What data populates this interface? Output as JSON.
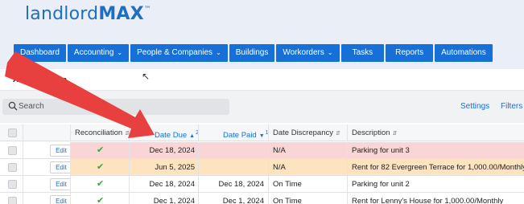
{
  "app": {
    "logo_light": "landlord",
    "logo_bold": "MAX",
    "logo_tm": "™"
  },
  "nav": [
    {
      "label": "Dashboard",
      "dropdown": false
    },
    {
      "label": "Accounting",
      "dropdown": true
    },
    {
      "label": "People & Companies",
      "dropdown": true
    },
    {
      "label": "Buildings",
      "dropdown": false
    },
    {
      "label": "Workorders",
      "dropdown": true
    },
    {
      "label": "Tasks",
      "dropdown": false
    },
    {
      "label": "Reports",
      "dropdown": false
    },
    {
      "label": "Automations",
      "dropdown": false
    }
  ],
  "page": {
    "title": "Accounting En"
  },
  "toolbar": {
    "search_placeholder": "Search",
    "settings_label": "Settings",
    "filters_label": "Filters"
  },
  "table": {
    "headers": {
      "reconciliation": "Reconciliation",
      "date_due": "Date Due",
      "date_due_sort": "2",
      "date_paid": "Date Paid",
      "date_paid_sort": "1",
      "date_discrepancy": "Date Discrepancy",
      "description": "Description"
    },
    "edit_label": "Edit",
    "rows": [
      {
        "due": "Dec 18, 2024",
        "paid": "",
        "discrepancy": "N/A",
        "description": "Parking for unit 3",
        "highlight": "#f9d5d5"
      },
      {
        "due": "Jun 5, 2025",
        "paid": "",
        "discrepancy": "N/A",
        "description": "Rent for 82 Evergreen Terrace for 1,000.00/Monthly",
        "highlight": "#fde3bf"
      },
      {
        "due": "Dec 18, 2024",
        "paid": "Dec 18, 2024",
        "discrepancy": "On Time",
        "description": "Parking for unit 2",
        "highlight": "#ffffff"
      },
      {
        "due": "Dec 1, 2024",
        "paid": "Dec 1, 2024",
        "discrepancy": "On Time",
        "description": "Rent for Lenny's House for 1,000.00/Monthly",
        "highlight": "#ffffff"
      }
    ]
  },
  "colors": {
    "brand": "#1670d8",
    "arrow": "#e8403f"
  }
}
